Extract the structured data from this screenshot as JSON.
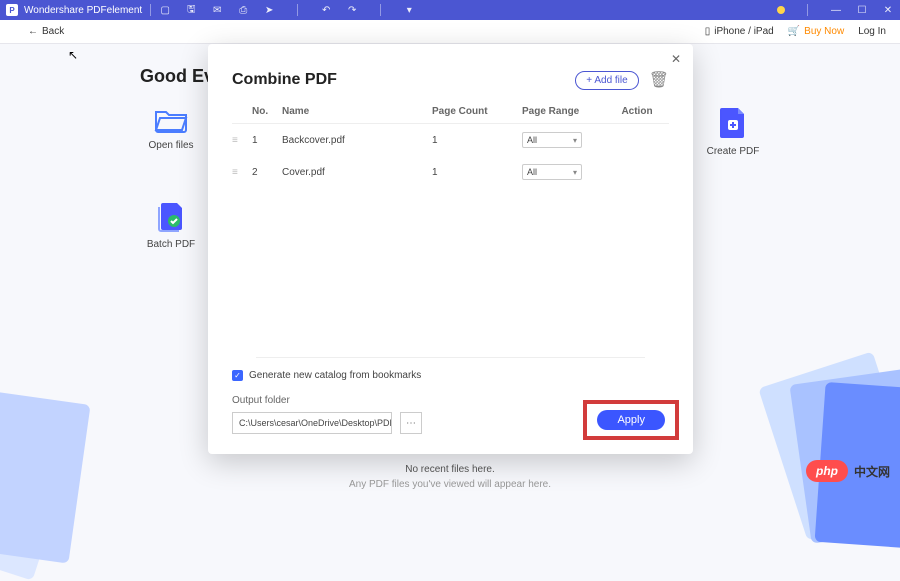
{
  "titlebar": {
    "app_name": "Wondershare PDFelement"
  },
  "subbar": {
    "back": "Back",
    "iphone": "iPhone / iPad",
    "buy": "Buy Now",
    "login": "Log In"
  },
  "greeting": "Good Evening",
  "tools": {
    "open": "Open files",
    "create": "Create PDF",
    "batch": "Batch PDF"
  },
  "recent": {
    "l1": "No recent files here.",
    "l2": "Any PDF files you've viewed will appear here."
  },
  "modal": {
    "title": "Combine PDF",
    "add_file": "+  Add file",
    "cols": {
      "no": "No.",
      "name": "Name",
      "page_count": "Page Count",
      "page_range": "Page Range",
      "action": "Action"
    },
    "rows": [
      {
        "no": "1",
        "name": "Backcover.pdf",
        "pages": "1",
        "range": "All"
      },
      {
        "no": "2",
        "name": "Cover.pdf",
        "pages": "1",
        "range": "All"
      }
    ],
    "gen_catalog": "Generate new catalog from bookmarks",
    "output_label": "Output folder",
    "output_value": "C:\\Users\\cesar\\OneDrive\\Desktop\\PDFelem",
    "apply": "Apply"
  },
  "phpbadge": {
    "pill": "php",
    "cn": "中文网"
  }
}
